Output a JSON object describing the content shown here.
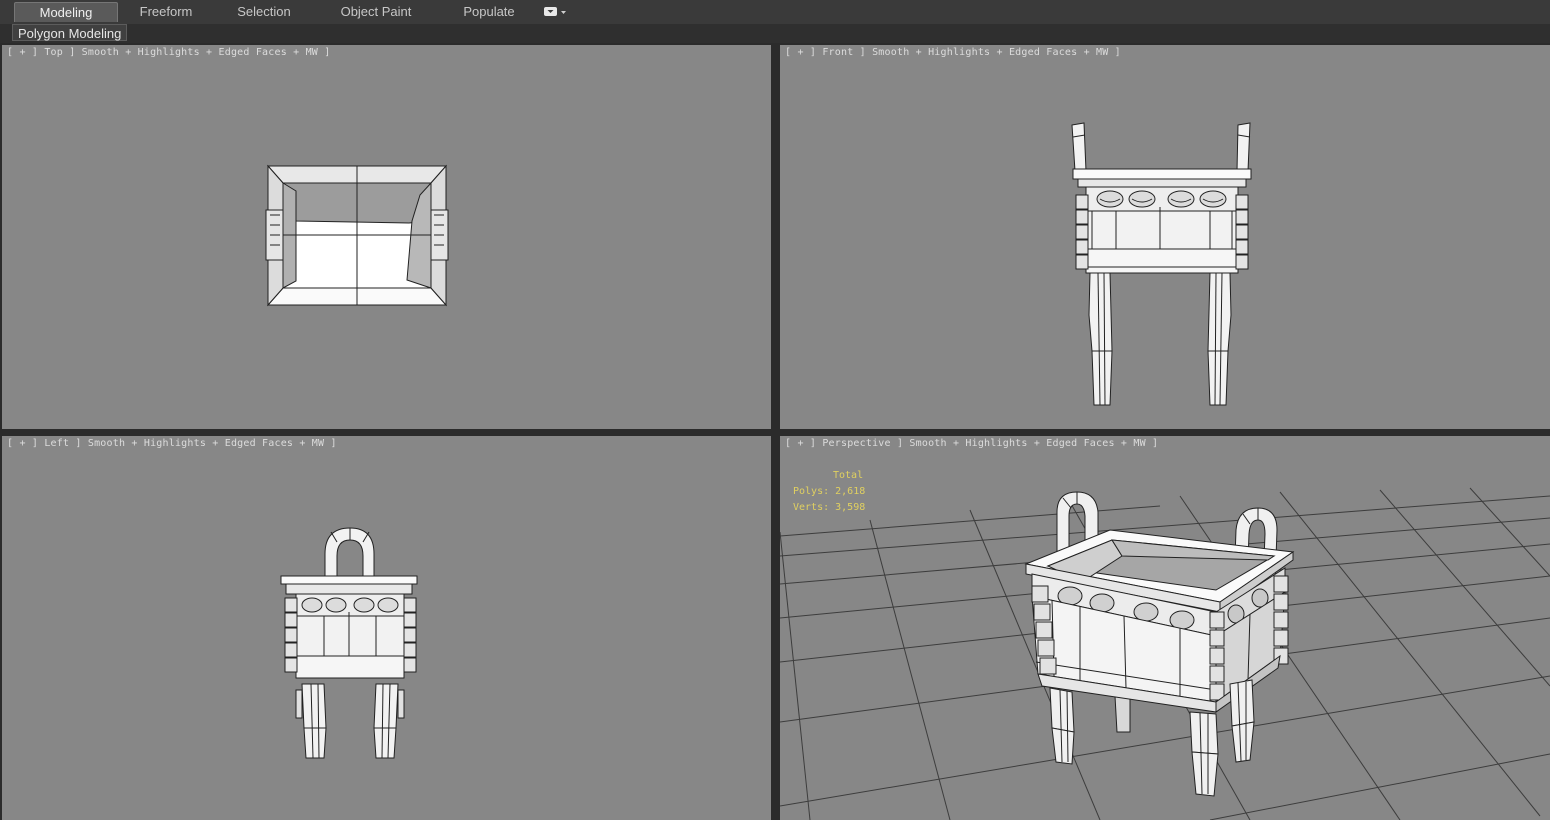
{
  "ribbon": {
    "tabs": [
      {
        "label": "Modeling",
        "active": true
      },
      {
        "label": "Freeform",
        "active": false
      },
      {
        "label": "Selection",
        "active": false
      },
      {
        "label": "Object Paint",
        "active": false
      },
      {
        "label": "Populate",
        "active": false
      }
    ],
    "panel_label": "Polygon Modeling"
  },
  "viewports": {
    "top": {
      "label": "[ + ] Top ] Smooth + Highlights + Edged Faces + MW ]"
    },
    "front": {
      "label": "[ + ] Front ] Smooth + Highlights + Edged Faces + MW ]"
    },
    "left": {
      "label": "[ + ] Left ] Smooth + Highlights + Edged Faces + MW ]"
    },
    "perspective": {
      "label": "[ + ] Perspective ] Smooth + Highlights + Edged Faces + MW ]",
      "stats": {
        "total": "Total",
        "polys": "Polys: 2,618",
        "verts": "Verts: 3,598"
      }
    }
  },
  "colors": {
    "viewport_bg": "#878787",
    "stats_text": "#e0d060",
    "ribbon_bg": "#3a3a3a"
  }
}
